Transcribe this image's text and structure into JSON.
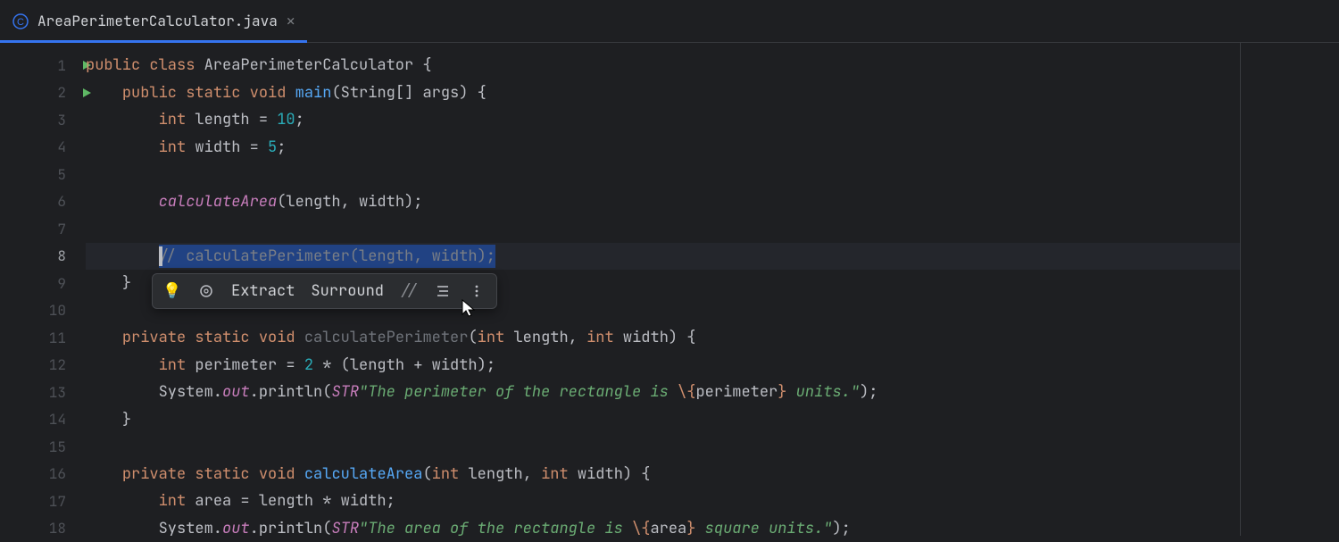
{
  "tab": {
    "title": "AreaPerimeterCalculator.java"
  },
  "lineNumbers": [
    "1",
    "2",
    "3",
    "4",
    "5",
    "6",
    "7",
    "8",
    "9",
    "10",
    "11",
    "12",
    "13",
    "14",
    "15",
    "16",
    "17",
    "18"
  ],
  "runMarkers": [
    1,
    2
  ],
  "toolbar": {
    "extract": "Extract",
    "surround": "Surround"
  },
  "code": {
    "l1": {
      "pre": "",
      "kw1": "public",
      "sp1": " ",
      "kw2": "class",
      "sp2": " ",
      "name": "AreaPerimeterCalculator",
      "post": " {"
    },
    "l2": {
      "indent": "    ",
      "kw1": "public",
      "sp1": " ",
      "kw2": "static",
      "sp2": " ",
      "kw3": "void",
      "sp3": " ",
      "fn": "main",
      "post": "(String[] args) {"
    },
    "l3": {
      "indent": "        ",
      "kw": "int",
      "sp": " ",
      "txt": "length = ",
      "num": "10",
      "semi": ";"
    },
    "l4": {
      "indent": "        ",
      "kw": "int",
      "sp": " ",
      "txt": "width = ",
      "num": "5",
      "semi": ";"
    },
    "l5": "",
    "l6": {
      "indent": "        ",
      "fn": "calculateArea",
      "post": "(length, width);"
    },
    "l7": "",
    "l8": {
      "indent": "        ",
      "sel": "// calculatePerimeter(length, width);"
    },
    "l9": {
      "indent": "    ",
      "txt": "}"
    },
    "l10": "",
    "l11": {
      "indent": "    ",
      "kw1": "private",
      "sp1": " ",
      "kw2": "static",
      "sp2": " ",
      "kw3": "void",
      "sp3": " ",
      "fn": "calculatePerimeter",
      "open": "(",
      "kw4": "int",
      "sp4": " ",
      "p1": "length, ",
      "kw5": "int",
      "sp5": " ",
      "p2": "width) {"
    },
    "l12": {
      "indent": "        ",
      "kw": "int",
      "sp": " ",
      "txt": "perimeter = ",
      "num": "2",
      "post": " * (length + width);"
    },
    "l13": {
      "indent": "        ",
      "pre": "System.",
      "id": "out",
      "mid": ".println(",
      "id2": "STR",
      ".": ".",
      "s1": "\"The perimeter of the rectangle is ",
      "esc": "\\{",
      "v": "perimeter",
      "cb": "}",
      "s2": " units.\"",
      "post": ");"
    },
    "l14": {
      "indent": "    ",
      "txt": "}"
    },
    "l15": "",
    "l16": {
      "indent": "    ",
      "kw1": "private",
      "sp1": " ",
      "kw2": "static",
      "sp2": " ",
      "kw3": "void",
      "sp3": " ",
      "fn": "calculateArea",
      "open": "(",
      "kw4": "int",
      "sp4": " ",
      "p1": "length, ",
      "kw5": "int",
      "sp5": " ",
      "p2": "width) {"
    },
    "l17": {
      "indent": "        ",
      "kw": "int",
      "sp": " ",
      "txt": "area = length * width;"
    },
    "l18": {
      "indent": "        ",
      "pre": "System.",
      "id": "out",
      "mid": ".println(",
      "id2": "STR",
      ".": ".",
      "s1": "\"The area of the rectangle is ",
      "esc": "\\{",
      "v": "area",
      "cb": "}",
      "s2": " square units.\"",
      "post": ");"
    }
  }
}
